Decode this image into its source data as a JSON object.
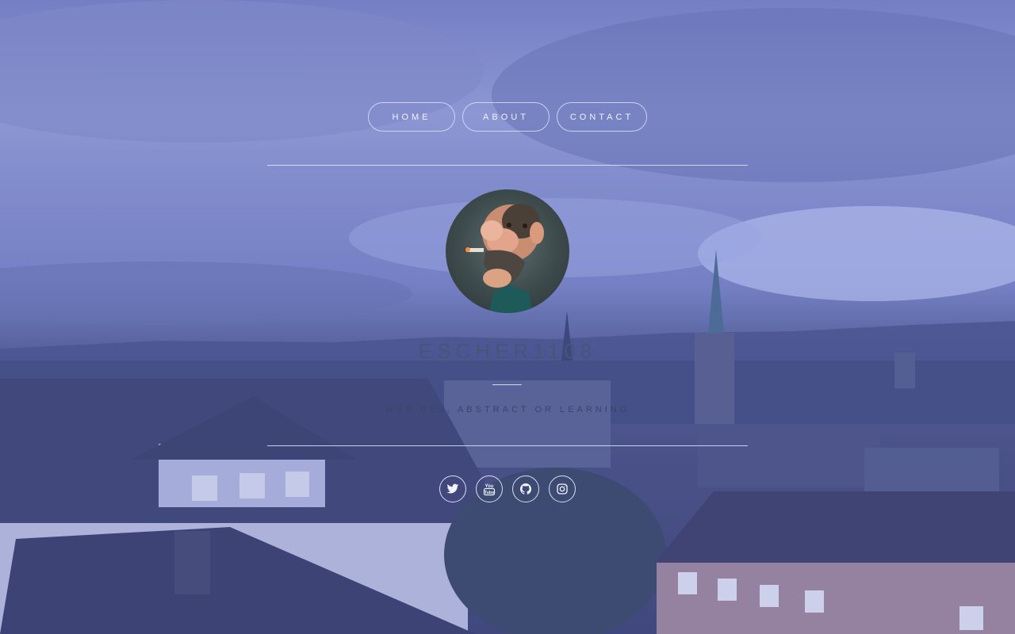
{
  "nav": {
    "items": [
      {
        "label": "HOME"
      },
      {
        "label": "ABOUT"
      },
      {
        "label": "CONTACT"
      }
    ]
  },
  "profile": {
    "title": "ESCHER1108",
    "subtitle": "WEB DEV, ABSTRACT OR LEARNING"
  },
  "social": [
    {
      "icon": "twitter-icon"
    },
    {
      "icon": "youtube-icon"
    },
    {
      "icon": "github-icon"
    },
    {
      "icon": "instagram-icon"
    }
  ],
  "colors": {
    "overlay": "#505cbe",
    "text_light": "#f1f3ff",
    "title": "#4a5478"
  }
}
